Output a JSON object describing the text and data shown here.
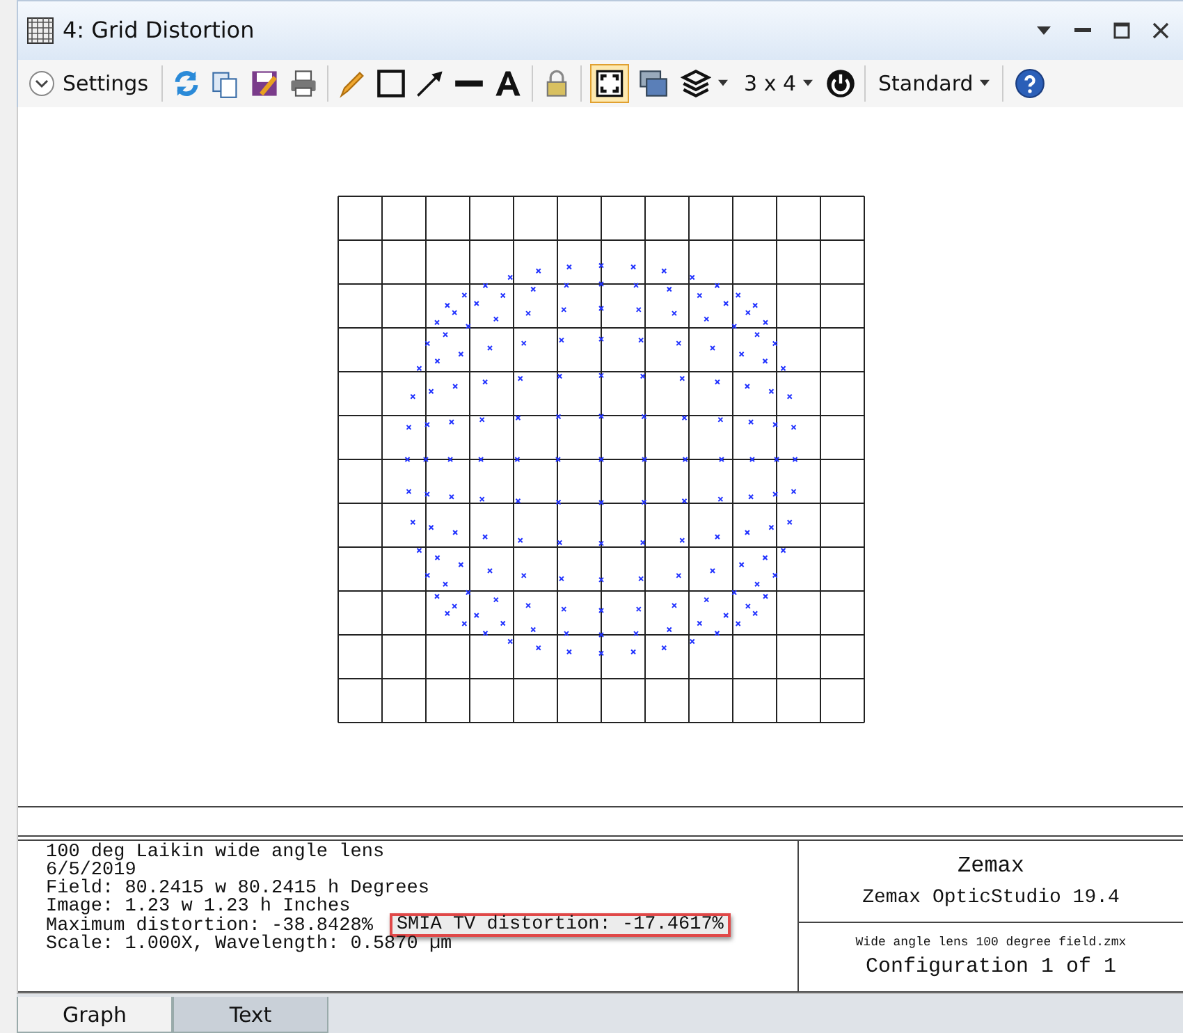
{
  "window": {
    "title": "4: Grid Distortion"
  },
  "toolbar": {
    "settings_label": "Settings",
    "layout_dropdown": "3 x 4",
    "style_dropdown": "Standard",
    "fit_toggle_on": true
  },
  "info": {
    "lines": [
      "100 deg Laikin wide angle lens",
      "6/5/2019",
      "Field: 80.2415 w 80.2415 h Degrees",
      "Image: 1.23 w 1.23 h Inches",
      "Maximum distortion: -38.8428%",
      "Scale: 1.000X, Wavelength: 0.5870 µm"
    ],
    "highlight": "SMIA TV distortion: -17.4617%",
    "company": "Zemax",
    "product": "Zemax OpticStudio 19.4",
    "file": "Wide angle lens 100 degree field.zmx",
    "configuration": "Configuration 1 of 1"
  },
  "tabs": [
    {
      "label": "Graph",
      "selected": true
    },
    {
      "label": "Text",
      "selected": false
    }
  ]
}
